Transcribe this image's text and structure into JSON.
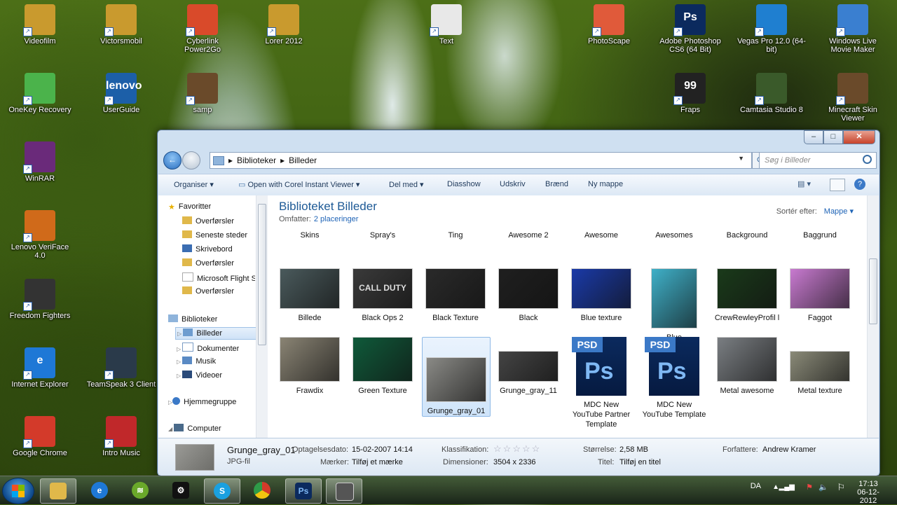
{
  "desktop": {
    "icons": [
      {
        "label": "Videofilm",
        "color": "#c99a2e"
      },
      {
        "label": "Victorsmobil",
        "color": "#c99a2e"
      },
      {
        "label": "Cyberlink Power2Go",
        "color": "#d94a2a"
      },
      {
        "label": "Lorer 2012",
        "color": "#c99a2e"
      },
      {
        "label": "Text",
        "color": "#e8e8e8"
      },
      {
        "label": "PhotoScape",
        "color": "#e05a3a"
      },
      {
        "label": "Adobe Photoshop CS6 (64 Bit)",
        "color": "#0b2a5e",
        "glyph": "Ps"
      },
      {
        "label": "Vegas Pro 12.0 (64-bit)",
        "color": "#1f7fd0"
      },
      {
        "label": "Windows Live Movie Maker",
        "color": "#3a7fd0"
      },
      {
        "label": "OneKey Recovery",
        "color": "#4bb34b"
      },
      {
        "label": "UserGuide",
        "color": "#1c5fa8",
        "glyph": "lenovo"
      },
      {
        "label": "samp",
        "color": "#6a4a2a"
      },
      {
        "label": "Fraps",
        "color": "#222222",
        "glyph": "99"
      },
      {
        "label": "Camtasia Studio 8",
        "color": "#3a5a2a"
      },
      {
        "label": "Minecraft Skin Viewer",
        "color": "#6a4a2a"
      },
      {
        "label": "WinRAR",
        "color": "#6a2a7a"
      },
      {
        "label": "Lenovo VeriFace 4.0",
        "color": "#d06a1a"
      },
      {
        "label": "Freedom Fighters",
        "color": "#333333"
      },
      {
        "label": "Internet Explorer",
        "color": "#1e78d6",
        "glyph": "e"
      },
      {
        "label": "TeamSpeak 3 Client",
        "color": "#2a3a4a"
      },
      {
        "label": "Google Chrome",
        "color": "#d33a2a"
      },
      {
        "label": "Intro Music",
        "color": "#c0282a"
      }
    ]
  },
  "explorer": {
    "breadcrumb": [
      "Biblioteker",
      "Billeder"
    ],
    "search_placeholder": "Søg i Billeder",
    "toolbar": [
      "Organiser ▾",
      "Open with Corel Instant Viewer ▾",
      "Del med ▾",
      "Diasshow",
      "Udskriv",
      "Brænd",
      "Ny mappe"
    ],
    "nav": {
      "favorites_label": "Favoritter",
      "favorites": [
        "Overførsler",
        "Seneste steder",
        "Skrivebord",
        "Overførsler",
        "Microsoft Flight Simulator",
        "Overførsler"
      ],
      "libraries_label": "Biblioteker",
      "libraries": [
        "Billeder",
        "Dokumenter",
        "Musik",
        "Videoer"
      ],
      "homegroup": "Hjemmegruppe",
      "computer": "Computer"
    },
    "library": {
      "title": "Biblioteket Billeder",
      "includes_label": "Omfatter:",
      "includes_link": "2 placeringer",
      "sort_label": "Sortér efter:",
      "sort_value": "Mappe ▾"
    },
    "row1": [
      {
        "label": "Skins"
      },
      {
        "label": "Spray's"
      },
      {
        "label": "Ting"
      },
      {
        "label": "Awesome 2"
      },
      {
        "label": "Awesome"
      },
      {
        "label": "Awesomes"
      },
      {
        "label": "Background"
      },
      {
        "label": "Baggrund"
      }
    ],
    "row2": [
      {
        "label": "Billede",
        "color": "#4a5a5c"
      },
      {
        "label": "Black Ops 2",
        "color": "#3a3a3a",
        "glyph": "CALL DUTY"
      },
      {
        "label": "Black Texture",
        "color": "#2a2a2a"
      },
      {
        "label": "Black",
        "color": "#1f1f1f"
      },
      {
        "label": "Blue texture",
        "color": "#1a3aa8"
      },
      {
        "label": "Blue",
        "color": "#3fb0c8"
      },
      {
        "label": "CrewRewleyProfil l",
        "color": "#1a3a1a"
      },
      {
        "label": "Faggot",
        "color": "#c87ad0"
      }
    ],
    "row3": [
      {
        "label": "Frawdix",
        "color": "#8a8474"
      },
      {
        "label": "Green Texture",
        "color": "#0f5a3a"
      },
      {
        "label": "Grunge_gray_01",
        "color": "#8a8a86"
      },
      {
        "label": "Grunge_gray_11",
        "color": "#444444"
      },
      {
        "label": "MDC New YouTube Partner Template",
        "psd": true
      },
      {
        "label": "MDC New YouTube Template",
        "psd": true
      },
      {
        "label": "Metal awesome",
        "color": "#7a7e82"
      },
      {
        "label": "Metal texture",
        "color": "#8a8a78"
      }
    ],
    "psd_tag": "PSD",
    "psd_glyph": "Ps",
    "details": {
      "name": "Grunge_gray_01",
      "type": "JPG-fil",
      "date_label": "Optagelsesdato:",
      "date_value": "15-02-2007 14:14",
      "tags_label": "Mærker:",
      "tags_value": "Tilføj et mærke",
      "rating_label": "Klassifikation:",
      "rating_value": 0,
      "dim_label": "Dimensioner:",
      "dim_value": "3504 x 2336",
      "size_label": "Størrelse:",
      "size_value": "2,58 MB",
      "title_label": "Titel:",
      "title_value": "Tilføj en titel",
      "author_label": "Forfattere:",
      "author_value": "Andrew Kramer"
    }
  },
  "taskbar": {
    "apps": [
      "Windows Explorer",
      "Internet Explorer",
      "Spotify",
      "Steam",
      "Skype",
      "Google Chrome",
      "Adobe Photoshop",
      "Capture"
    ],
    "lang": "DA",
    "time": "17:13",
    "date": "06-12-2012"
  }
}
